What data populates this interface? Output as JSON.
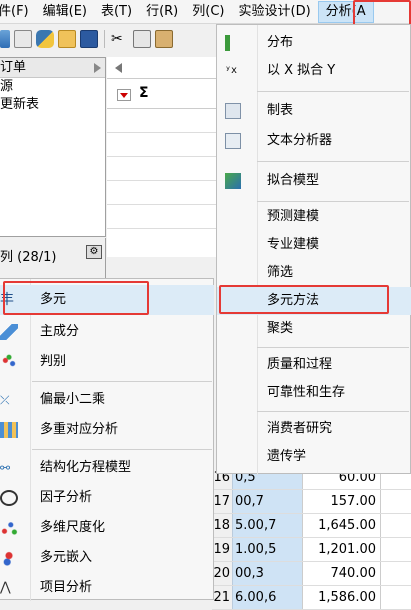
{
  "menubar": {
    "items": [
      "件(F)",
      "编辑(E)",
      "表(T)",
      "行(R)",
      "列(C)",
      "实验设计(D)",
      "分析(A"
    ]
  },
  "left_panel": {
    "header": "订单",
    "rows": [
      "源",
      "更新表"
    ]
  },
  "columns_panel": {
    "label": "列 (28/1)"
  },
  "analyze_menu": {
    "items": [
      {
        "label": "分布",
        "icon": "distribution-icon"
      },
      {
        "label": "以 X 拟合 Y",
        "icon": "fit-y-by-x-icon"
      },
      {
        "label": "制表",
        "icon": "tabulate-icon"
      },
      {
        "label": "文本分析器",
        "icon": "text-explorer-icon"
      },
      {
        "label": "拟合模型",
        "icon": "fit-model-icon"
      },
      {
        "label": "预测建模",
        "icon": ""
      },
      {
        "label": "专业建模",
        "icon": ""
      },
      {
        "label": "筛选",
        "icon": ""
      },
      {
        "label": "多元方法",
        "icon": ""
      },
      {
        "label": "聚类",
        "icon": ""
      },
      {
        "label": "质量和过程",
        "icon": ""
      },
      {
        "label": "可靠性和生存",
        "icon": ""
      },
      {
        "label": "消费者研究",
        "icon": ""
      },
      {
        "label": "遗传学",
        "icon": ""
      }
    ]
  },
  "multivariate_menu": {
    "items": [
      {
        "label": "多元",
        "icon": "multivariate-icon"
      },
      {
        "label": "主成分",
        "icon": "principal-components-icon"
      },
      {
        "label": "判别",
        "icon": "discriminant-icon"
      },
      {
        "label": "偏最小二乘",
        "icon": "pls-icon"
      },
      {
        "label": "多重对应分析",
        "icon": "mca-icon"
      },
      {
        "label": "结构化方程模型",
        "icon": "sem-icon"
      },
      {
        "label": "因子分析",
        "icon": "factor-analysis-icon"
      },
      {
        "label": "多维尺度化",
        "icon": "mds-icon"
      },
      {
        "label": "多元嵌入",
        "icon": "embedding-icon"
      },
      {
        "label": "项目分析",
        "icon": "item-analysis-icon"
      }
    ]
  },
  "table_rows": [
    {
      "num": "16",
      "key": "0,5",
      "value": "60.00"
    },
    {
      "num": "17",
      "key": "00,7",
      "value": "157.00"
    },
    {
      "num": "18",
      "key": "5.00,7",
      "value": "1,645.00"
    },
    {
      "num": "19",
      "key": "1.00,5",
      "value": "1,201.00"
    },
    {
      "num": "20",
      "key": "00,3",
      "value": "740.00"
    },
    {
      "num": "21",
      "key": "6.00,6",
      "value": "1,586.00"
    }
  ],
  "colors": {
    "highlight": "#e53935",
    "menu_active": "#cce4f7",
    "selected_cell": "#cfe3f5"
  }
}
